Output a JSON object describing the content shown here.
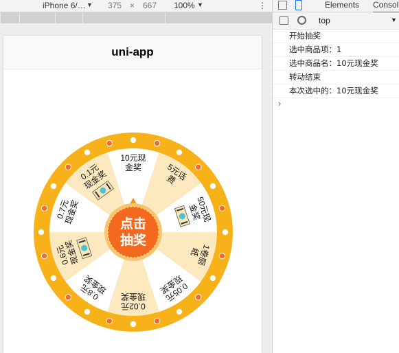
{
  "devtools_bar": {
    "device": "iPhone 6/…",
    "width": "375",
    "times": "×",
    "height": "667",
    "zoom": "100%",
    "more": "⋮"
  },
  "app": {
    "title": "uni-app"
  },
  "wheel": {
    "center_line1": "点击",
    "center_line2": "抽奖",
    "prizes": [
      {
        "line1": "10元现",
        "line2": "金奖",
        "has_icon": false
      },
      {
        "line1": "5元话",
        "line2": "费",
        "has_icon": false
      },
      {
        "line1": "50元现",
        "line2": "金奖",
        "has_icon": true
      },
      {
        "line1": "1卷厕",
        "line2": "纸",
        "has_icon": false
      },
      {
        "line1": "0.05元",
        "line2": "现金奖",
        "has_icon": false
      },
      {
        "line1": "0.02元",
        "line2": "现金奖",
        "has_icon": false
      },
      {
        "line1": "0.8元",
        "line2": "现金奖",
        "has_icon": false
      },
      {
        "line1": "0.6元",
        "line2": "现金奖",
        "has_icon": true
      },
      {
        "line1": "0.7元",
        "line2": "现金奖",
        "has_icon": false
      },
      {
        "line1": "0.1元",
        "line2": "现金奖",
        "has_icon": true
      }
    ],
    "colors": {
      "rim": "#f7b219",
      "sector_light": "#fde9bf",
      "sector_white": "#ffffff",
      "dot_white": "#ffffff",
      "dot_orange": "#f5692d",
      "button": "#f5691e",
      "pointer": "#f7961e",
      "icon": "#4bc3d4"
    }
  },
  "console": {
    "tabs": [
      "Elements",
      "Console"
    ],
    "context": "top",
    "logs": [
      "开始抽奖",
      "选中商品项：1",
      "选中商品名：10元现金奖",
      "转动结束",
      "本次选中的：10元现金奖"
    ],
    "prompt": "›"
  }
}
